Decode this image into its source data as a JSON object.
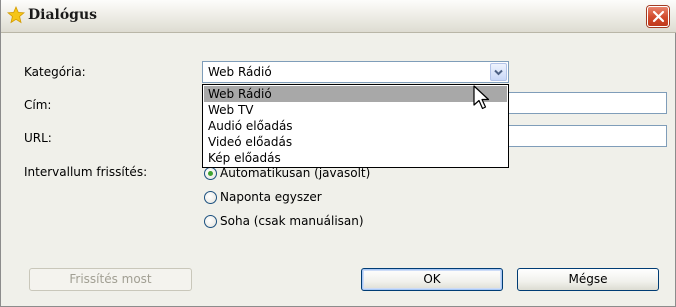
{
  "window": {
    "title": "Dialógus"
  },
  "form": {
    "category_label": "Kategória:",
    "title_label": "Cím:",
    "url_label": "URL:",
    "refresh_label": "Intervallum frissítés:"
  },
  "category_combo": {
    "selected": "Web Rádió",
    "options": [
      "Web Rádió",
      "Web TV",
      "Audió előadás",
      "Videó előadás",
      "Kép előadás"
    ]
  },
  "refresh_options": [
    {
      "label": "Automatikusan (javasolt)",
      "checked": true
    },
    {
      "label": "Naponta egyszer",
      "checked": false
    },
    {
      "label": "Soha (csak manuálisan)",
      "checked": false
    }
  ],
  "buttons": {
    "refresh_now": "Frissítés most",
    "ok": "OK",
    "cancel": "Mégse"
  },
  "colors": {
    "dialog_bg": "#f0f0ea",
    "close_button": "#d14a2b",
    "dropdown_highlight": "#a8a8a8",
    "radio_checked": "#3ea230"
  }
}
